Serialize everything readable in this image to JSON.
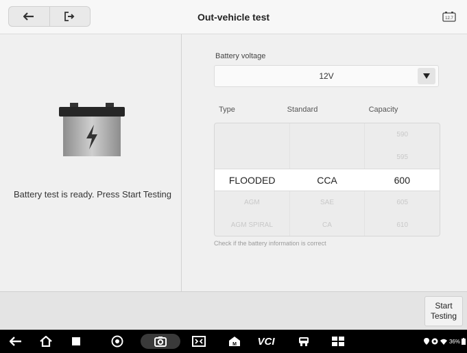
{
  "header": {
    "title": "Out-vehicle test",
    "battery_badge": "12.7"
  },
  "left": {
    "status_text": "Battery test is ready. Press Start Testing"
  },
  "voltage": {
    "label": "Battery voltage",
    "value": "12V"
  },
  "table": {
    "headers": [
      "Type",
      "Standard",
      "Capacity"
    ],
    "rows": [
      [
        "",
        "",
        "590"
      ],
      [
        "",
        "",
        "595"
      ],
      [
        "FLOODED",
        "CCA",
        "600"
      ],
      [
        "AGM",
        "SAE",
        "605"
      ],
      [
        "AGM SPIRAL",
        "CA",
        "610"
      ]
    ],
    "selected_index": 2
  },
  "hint": "Check if the battery information is correct",
  "actions": {
    "start_label": "Start Testing"
  },
  "navbar": {
    "vci_label": "VCI",
    "status_text": "36%"
  }
}
